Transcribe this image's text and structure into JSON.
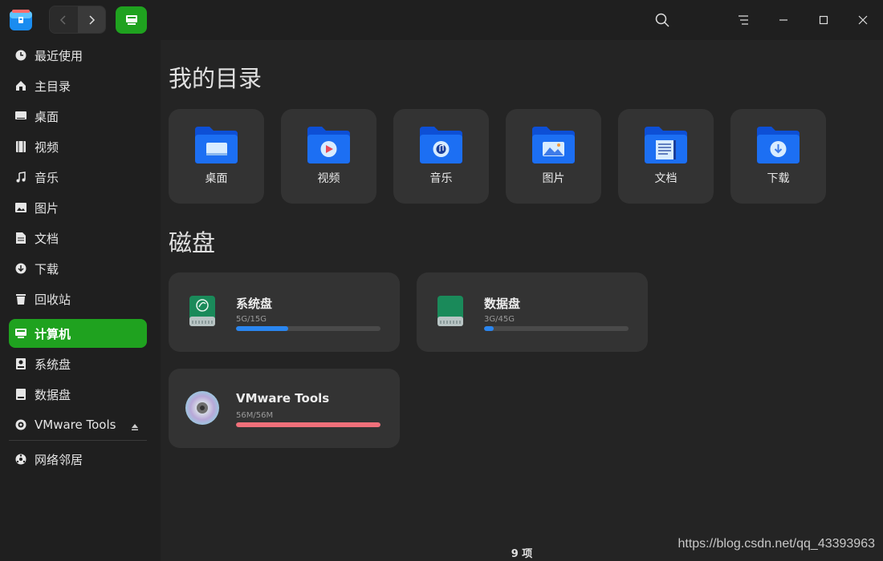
{
  "window": {
    "status": "9 项",
    "watermark": "https://blog.csdn.net/qq_43393963"
  },
  "titlebar": {
    "icons": [
      "app-logo-icon",
      "back-icon",
      "forward-icon",
      "computer-icon",
      "search-icon",
      "menu-icon",
      "minimize-icon",
      "maximize-icon",
      "close-icon"
    ]
  },
  "sidebar": {
    "items": [
      {
        "label": "最近使用",
        "icon": "clock-icon"
      },
      {
        "label": "主目录",
        "icon": "home-icon"
      },
      {
        "label": "桌面",
        "icon": "desktop-icon"
      },
      {
        "label": "视频",
        "icon": "film-icon"
      },
      {
        "label": "音乐",
        "icon": "music-icon"
      },
      {
        "label": "图片",
        "icon": "image-icon"
      },
      {
        "label": "文档",
        "icon": "document-icon"
      },
      {
        "label": "下载",
        "icon": "download-icon"
      },
      {
        "label": "回收站",
        "icon": "trash-icon"
      },
      {
        "label": "计算机",
        "icon": "computer-icon",
        "active": true
      },
      {
        "label": "系统盘",
        "icon": "disk-icon"
      },
      {
        "label": "数据盘",
        "icon": "disk-icon"
      },
      {
        "label": "VMware Tools",
        "icon": "cdrom-icon"
      },
      {
        "label": "网络邻居",
        "icon": "network-icon"
      }
    ],
    "accent": "#1fa21f"
  },
  "main": {
    "directories_title": "我的目录",
    "folders": [
      {
        "label": "桌面",
        "icon": "desktop-folder-icon"
      },
      {
        "label": "视频",
        "icon": "video-folder-icon"
      },
      {
        "label": "音乐",
        "icon": "music-folder-icon"
      },
      {
        "label": "图片",
        "icon": "pictures-folder-icon"
      },
      {
        "label": "文档",
        "icon": "documents-folder-icon"
      },
      {
        "label": "下载",
        "icon": "downloads-folder-icon"
      }
    ],
    "disks_title": "磁盘",
    "disks": [
      {
        "name": "系统盘",
        "size": "5G/15G",
        "used": 0.36,
        "icon": "system-disk-icon"
      },
      {
        "name": "数据盘",
        "size": "3G/45G",
        "used": 0.067,
        "icon": "data-disk-icon"
      },
      {
        "name": "VMware Tools",
        "size": "56M/56M",
        "used": 1.0,
        "icon": "cdrom-disc-icon"
      }
    ]
  }
}
